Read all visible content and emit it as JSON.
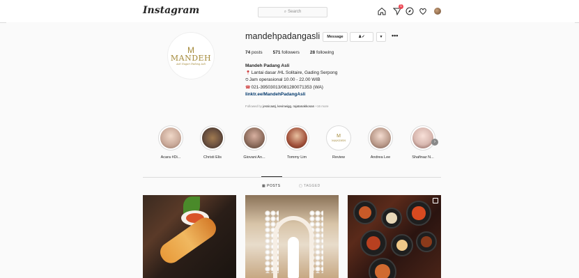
{
  "header": {
    "logo": "Instagram",
    "search_placeholder": "Search",
    "notification_count": "1"
  },
  "profile": {
    "username": "mandehpadangasli",
    "message_button": "Message",
    "follow_icon_label": "♟✓",
    "dropdown_label": "▾",
    "more_label": "•••",
    "logo_mark": "M",
    "logo_name": "MANDEH",
    "logo_tagline": "Asli Nagari Padang Asli",
    "stats": {
      "posts_count": "74",
      "posts_label": "posts",
      "followers_count": "571",
      "followers_label": "followers",
      "following_count": "28",
      "following_label": "following"
    },
    "bio": {
      "name": "Mandeh Padang Asli",
      "location": "Lantai dasar /HL Solitaire, Gading Serpong",
      "hours": "Jam operasional 10.00 - 22.00 WIB",
      "phone": "021-39503013/081280071353 (WA)",
      "link": "linktr.ee/MandehPadangAsli"
    },
    "followed_by_prefix": "Followed by",
    "followed_by_names": "jessicaatj, kevinwigg, rajatanakkosan",
    "followed_by_more": "+16 more"
  },
  "highlights": [
    {
      "label": "Acara #Di...",
      "color": "#c8a898"
    },
    {
      "label": "Christi Elis",
      "color": "#6a5040"
    },
    {
      "label": "Giovani An...",
      "color": "#8a6a5a"
    },
    {
      "label": "Tommy Lim",
      "color": "#a0503a"
    },
    {
      "label": "Review",
      "color": "#ffffff"
    },
    {
      "label": "Andrea Lee",
      "color": "#b89888"
    },
    {
      "label": "Shafinaz N...",
      "color": "#d8b8b0"
    }
  ],
  "tabs": {
    "posts": "POSTS",
    "tagged": "TAGGED"
  },
  "icons": {
    "search": "search-icon",
    "home": "home-icon",
    "direct": "direct-icon",
    "explore": "compass-icon",
    "activity": "heart-icon",
    "profile": "avatar"
  }
}
